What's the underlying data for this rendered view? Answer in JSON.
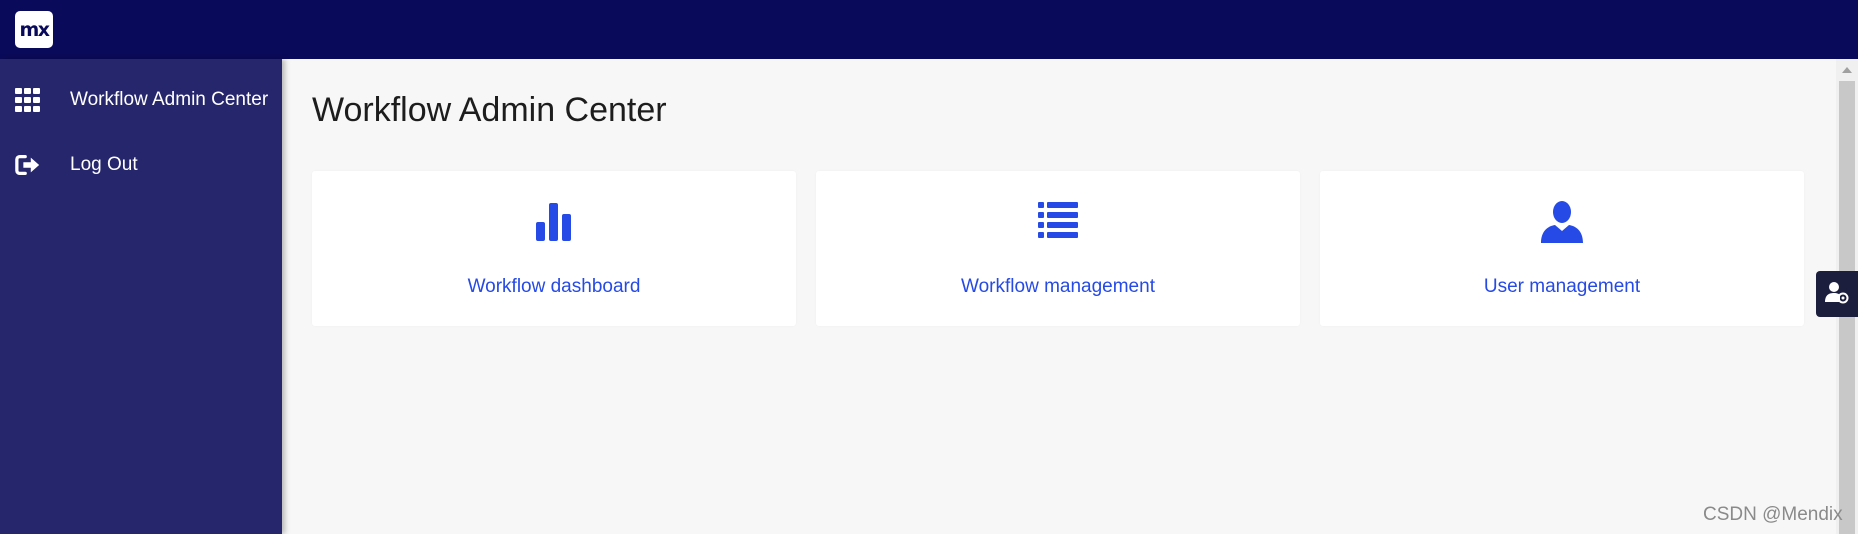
{
  "topbar": {
    "logo_text": "mx",
    "background": "#0a0a5a"
  },
  "sidebar": {
    "background": "#25266b",
    "items": [
      {
        "label": "Workflow Admin Center",
        "icon": "grid-icon"
      },
      {
        "label": "Log Out",
        "icon": "logout-icon"
      }
    ]
  },
  "main": {
    "title": "Workflow Admin Center",
    "cards": [
      {
        "label": "Workflow dashboard",
        "icon": "bar-chart-icon"
      },
      {
        "label": "Workflow management",
        "icon": "list-icon"
      },
      {
        "label": "User management",
        "icon": "user-icon"
      }
    ],
    "accent_color": "#264ae5"
  },
  "helper": {
    "icon": "user-settings-icon"
  },
  "watermark": "CSDN @Mendix"
}
